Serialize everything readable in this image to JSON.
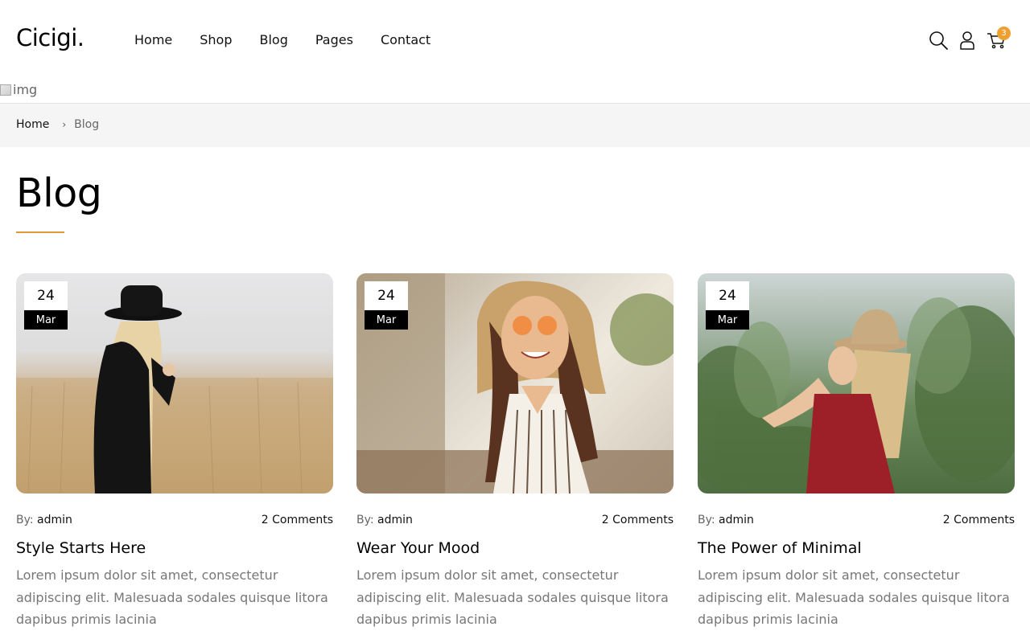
{
  "brand": {
    "logo": "Cicigi."
  },
  "nav": {
    "items": [
      "Home",
      "Shop",
      "Blog",
      "Pages",
      "Contact"
    ]
  },
  "header_icons": {
    "search": "search-icon",
    "user": "user-icon",
    "cart": "cart-icon",
    "cart_count": "3",
    "badge_color": "#f0a030"
  },
  "broken_image": {
    "alt": "img"
  },
  "breadcrumb": {
    "home": "Home",
    "separator": "›",
    "current": "Blog"
  },
  "page": {
    "title": "Blog",
    "accent": "#e09a3a"
  },
  "posts": [
    {
      "day": "24",
      "month": "Mar",
      "by_label": "By:",
      "author": "admin",
      "comments": "2 Comments",
      "title": "Style Starts Here",
      "excerpt": "Lorem ipsum dolor sit amet, consectetur adipiscing elit. Malesuada sodales quisque litora dapibus primis lacinia"
    },
    {
      "day": "24",
      "month": "Mar",
      "by_label": "By:",
      "author": "admin",
      "comments": "2 Comments",
      "title": "Wear Your Mood",
      "excerpt": "Lorem ipsum dolor sit amet, consectetur adipiscing elit. Malesuada sodales quisque litora dapibus primis lacinia"
    },
    {
      "day": "24",
      "month": "Mar",
      "by_label": "By:",
      "author": "admin",
      "comments": "2 Comments",
      "title": "The Power of Minimal",
      "excerpt": "Lorem ipsum dolor sit amet, consectetur adipiscing elit. Malesuada sodales quisque litora dapibus primis lacinia"
    }
  ]
}
